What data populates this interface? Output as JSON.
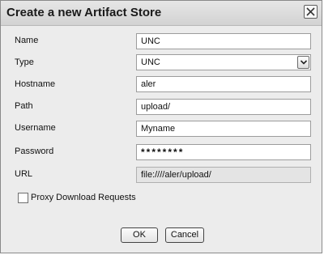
{
  "dialog": {
    "title": "Create a new Artifact Store",
    "close_icon": "close-icon"
  },
  "form": {
    "name": {
      "label": "Name",
      "value": "UNC"
    },
    "type": {
      "label": "Type",
      "value": "UNC",
      "dropdown_icon": "chevron-down-icon"
    },
    "hostname": {
      "label": "Hostname",
      "value": "aler"
    },
    "path": {
      "label": "Path",
      "value": "upload/"
    },
    "username": {
      "label": "Username",
      "value": "Myname"
    },
    "password": {
      "label": "Password",
      "value": "********"
    },
    "url": {
      "label": "URL",
      "value": "file:////aler/upload/"
    }
  },
  "proxy": {
    "label": "Proxy Download Requests",
    "checked": false
  },
  "buttons": {
    "ok": "OK",
    "cancel": "Cancel"
  }
}
